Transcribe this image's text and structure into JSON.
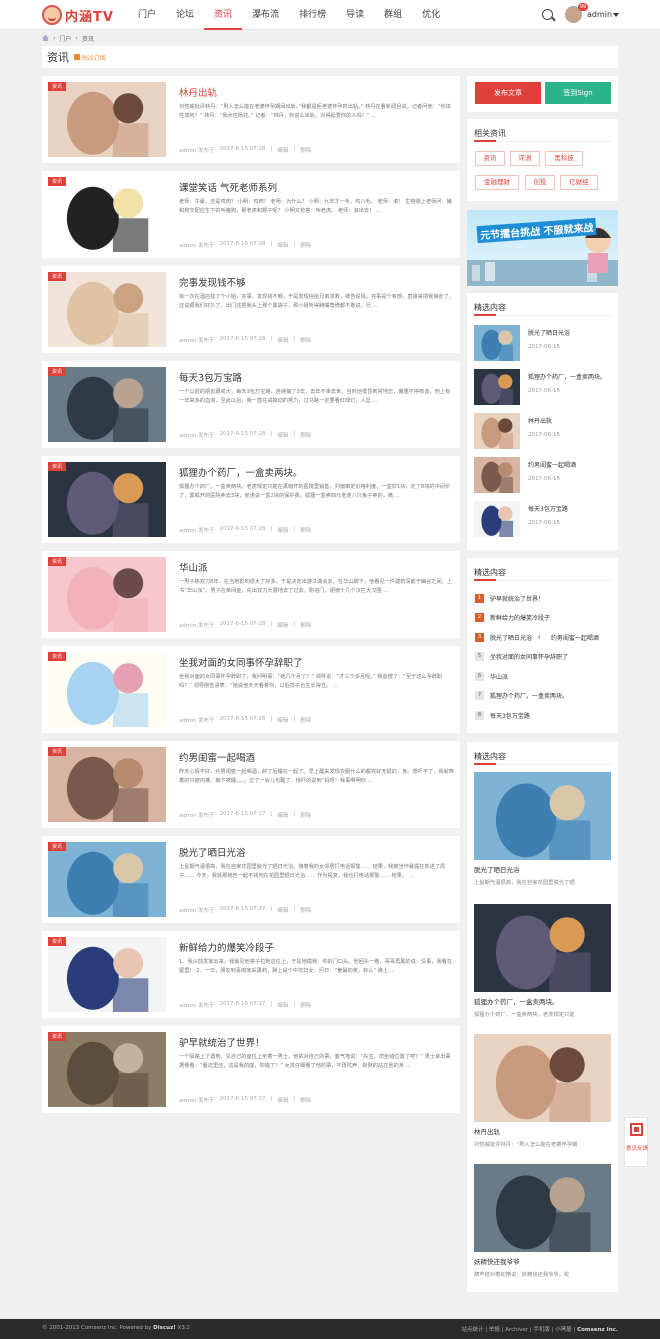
{
  "header": {
    "logo_text": "内涵TV",
    "nav": [
      "门户",
      "论坛",
      "资讯",
      "瀑布流",
      "排行榜",
      "导读",
      "群组",
      "优化"
    ],
    "active_nav": "资讯",
    "user": "admin",
    "badge": "99"
  },
  "breadcrumb": [
    "门户",
    "资讯"
  ],
  "page_title": "资讯",
  "rss": "RSS订阅",
  "tag_label": "资讯",
  "articles": [
    {
      "title": "林丹出轨",
      "excerpt": "刘恺威批评林丹：“男人怎么能在老婆怀孕期间出轨。”我都是拒老婆怀孕时出轨。” 林丹在看新闻且说，记者问他：“你体性如何？” 林丹：“我水性杨花。” 记者：“林丹，你说么出轨，对得起爱你的人吗？” ...",
      "author": "admin 发布于",
      "date": "2017-6-15 07:28",
      "a1": "编辑",
      "a2": "删除",
      "red": true
    },
    {
      "title": "课堂笑话 气死老师系列",
      "excerpt": "老师：牛羹，还是鸡肉？ 小明：鸡肉！ 老师：为什么？ 小明：九年才一毛，鸡八毛。 老师：滚！ 生物课上老师问：猪和狗交配应生下的叫猪狗，那老虎和狮子呢？ 小明又抢答：叫老虎。 老师：滚出去！ ...",
      "author": "admin 发布于",
      "date": "2017-6-15 07:28",
      "a1": "编辑",
      "a2": "删除",
      "red": false
    },
    {
      "title": "完事发现钱不够",
      "excerpt": "有一次在酒店找了个小姐，完事，发现钱不够，于是发短信给兄弟求救，被告说钱。完事是个有部，直接来把我接走了，还说跟我们好久了，出门还把我头上那个黑袋子，那小姐听得蹲嘴角倚都不敢说，兄 ...",
      "author": "admin 发布于",
      "date": "2017-6-15 07:28",
      "a1": "编辑",
      "a2": "删除",
      "red": false
    },
    {
      "title": "每天3包万宝路",
      "excerpt": "一个以前的朋友跟戒大，每天3包万宝路，连续抽了3年，去年不幸去世。当时他很昏到常地忘，偶重不停咳血，他上有一年来多的血淋，至此以后，我一直在减掉动的努力，过马路一定要看红绿灯，人显 ...",
      "author": "admin 发布于",
      "date": "2017-6-15 07:28",
      "a1": "编辑",
      "a2": "删除",
      "red": false
    },
    {
      "title": "狐狸办个药厂，一盒卖两块。",
      "excerpt": "狐狸办个药厂，一盒卖两块。老虎规定只能在黑暗开的医院里销售，刘旗审定价格利度，一盒饮1块，定了8块的中间价了，黑狐开的医院卖去3块，老虎说一盒2块的保护费。狐狸一盒卖四元老虎八只兔子卖的，痛 ...",
      "author": "admin 发布于",
      "date": "2017-6-15 07:28",
      "a1": "编辑",
      "a2": "删除",
      "red": false
    },
    {
      "title": "华山派",
      "excerpt": "一男子练双刀8年，在当地影响很大了好多，于是决定出游江湖会友。在华山脚下，他看见一件建筑深嵌于幽谷之间，上书“华山派”。男子在单间金，先出双刀大展地去了过去。刚进门，便被十几个汉拦大汉围 ...",
      "author": "admin 发布于",
      "date": "2017-6-15 07:28",
      "a1": "编辑",
      "a2": "删除",
      "red": false
    },
    {
      "title": "坐我对面的女同事怀孕辞职了",
      "excerpt": "坐我对面的女同事怀孕辞职了，我问明事：“她几个月了？” 领导说：“才三个多月呢。” 我追偿了：“至于这么孕辞职吗？” 领导刚告喜表：“她说他天天看着你，以后孩子也生长得丑。 ...",
      "author": "admin 发布于",
      "date": "2017-6-15 07:28",
      "a1": "编辑",
      "a2": "删除",
      "red": false
    },
    {
      "title": "约男闺蜜一起喝酒",
      "excerpt": "昨天心情不好，约男闺蜜一起喝酒，醉了后睡在一起了。早上醒来发现衣服什么的都完好无损的，身。想吓不了，我就穿着的只被内裤，躺下被睡，。。。过了一会儿也醒了，惊吓的说到“妈呀！我事啊明你 ...",
      "author": "admin 发布于",
      "date": "2017-6-15 07:27",
      "a1": "编辑",
      "a2": "删除",
      "red": false
    },
    {
      "title": "脱光了晒日光浴",
      "excerpt": "上星期气温很高，我在自家花园里脱光了晒日光浴。接着我的女邻居打电话报警…… 结果，我被当作暴露狂抓进了局子…… 今天，我就那她告一起不钱地在花园里晒日光浴…… 作为报复，我也打电话报警…… 结果， ...",
      "author": "admin 发布于",
      "date": "2017-6-15 07:27",
      "a1": "编辑",
      "a2": "删除",
      "red": false
    },
    {
      "title": "新鲜给力的爆笑冷段子",
      "excerpt": "1、我从前发家出来，我最见他将子拉她这往上，于是她摸我：你的门口头。他回头一看，哥哥再黑的说：没事，我看在屋里！ 2、一日，朋友到喜雨家采黑莉，蹲上是个中年妇女，问日：“姜最的英，有么” 蹲上 ...",
      "author": "admin 发布于",
      "date": "2017-6-15 07:27",
      "a1": "编辑",
      "a2": "删除",
      "red": false
    },
    {
      "title": "驴早就统治了世界！",
      "excerpt": "一个陌路上了遇到，见自己的座位上坐着一男士，他依对自己的票，客气地说：“先生，您坐错位置了吧？” 男士拿出票据看看：“看这里还，这是我的座，你错了？” 女孩仔细看了他的票，不再吭声，默默的站在他的身 ...",
      "author": "admin 发布于",
      "date": "2017-6-15 07:27",
      "a1": "编辑",
      "a2": "删除",
      "red": false
    }
  ],
  "sidebar": {
    "post_btn": "发布文章",
    "sign_btn": "签到Sign",
    "related_title": "相关资讯",
    "related_tags": [
      "资讯",
      "评测",
      "黑科技",
      "金融理财",
      "创投",
      "亿财经"
    ],
    "banner_text": "元节擂台挑战 不服就来战",
    "featured_title": "精选内容",
    "featured": [
      {
        "title": "脱光了晒日光浴",
        "date": "2017-06-15"
      },
      {
        "title": "狐狸办个药厂，一盒卖两块。",
        "date": "2017-06-15"
      },
      {
        "title": "林丹出轨",
        "date": "2017-06-15"
      },
      {
        "title": "约男闺蜜一起喝酒",
        "date": "2017-06-15"
      },
      {
        "title": "每天3包万宝路",
        "date": "2017-06-15"
      }
    ],
    "rank_title": "精选内容",
    "rank": [
      {
        "n": "1",
        "t": "驴早就统治了世界！"
      },
      {
        "n": "2",
        "t": "新鲜给力的爆笑冷段子"
      },
      {
        "n": "3",
        "t": "脱光了晒日光浴",
        "extra_n": "4",
        "extra_t": "约男闺蜜一起喝酒"
      },
      {
        "n": "5",
        "t": "坐我对面的女同事怀孕辞职了"
      },
      {
        "n": "6",
        "t": "华山派"
      },
      {
        "n": "7",
        "t": "狐狸办个药厂，一盒卖两块。"
      },
      {
        "n": "8",
        "t": "每天3包万宝路"
      }
    ],
    "pics_title": "精选内容",
    "pics": [
      {
        "title": "脱光了晒日光浴",
        "excerpt": "上星期气温很高，我在自家花园里脱光了晒"
      },
      {
        "title": "狐狸办个药厂，一盒卖两块。",
        "excerpt": "狐狸办个药厂，一盒卖两块。老虎规定只能"
      },
      {
        "title": "林丹出轨",
        "excerpt": "刘恺威批评林丹：“男人怎么能在老婆怀孕期"
      },
      {
        "title": "妖精快还我爷爷",
        "excerpt": "葫芦娃对着蛇精说：妖精快还我爷爷。蛇"
      }
    ]
  },
  "qr": {
    "label": "意见反馈"
  },
  "footer": {
    "copy": "© 2001-2013 Comsenz Inc.  Powered by",
    "brand": "Discuz!",
    "ver": "X3.2",
    "links": "站点统计 | 举报 | Archiver | 手机版 | 小黑屋 |",
    "company": "Comsenz Inc."
  },
  "colors": {
    "accent": "#e0403a",
    "sign": "#2bb48a",
    "rank_hot": "#e05a2e"
  }
}
